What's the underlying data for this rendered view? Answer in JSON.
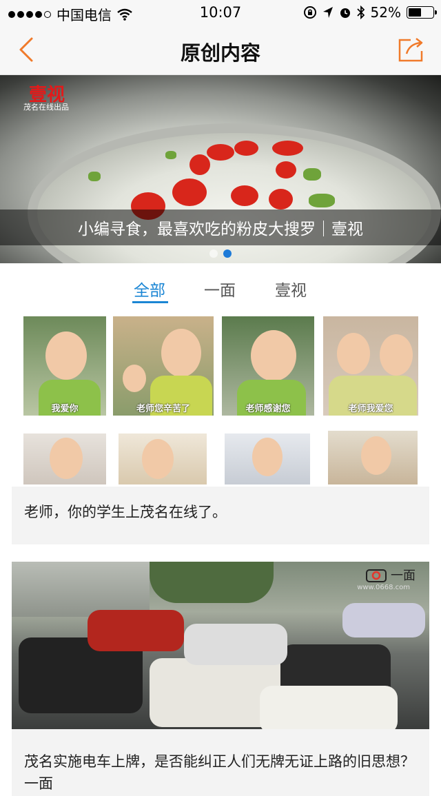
{
  "status_bar": {
    "carrier": "中国电信",
    "time": "10:07",
    "battery": "52%",
    "battery_level": 0.52
  },
  "nav": {
    "title": "原创内容",
    "back_icon": "chevron-left-icon",
    "share_icon": "share-icon",
    "accent": "#f07a2a"
  },
  "banner": {
    "logo_text": "壹视",
    "logo_sub": "茂名在线出品",
    "caption": "小编寻食，最喜欢吃的粉皮大搜罗｜壹视",
    "pages": 2,
    "active_page": 1
  },
  "tabs": {
    "items": [
      {
        "label": "全部"
      },
      {
        "label": "一面"
      },
      {
        "label": "壹视"
      }
    ],
    "active": 0,
    "active_color": "#1b86d4"
  },
  "feed": [
    {
      "title": "老师，你的学生上茂名在线了。",
      "thumbs": [
        "我爱你",
        "老师您辛苦了",
        "老师感谢您",
        "老师我爱您"
      ]
    },
    {
      "title": "茂名实施电车上牌，是否能纠正人们无牌无证上路的旧思想？一面",
      "watermark": "一面",
      "watermark_sub": "www.0668.com"
    }
  ]
}
